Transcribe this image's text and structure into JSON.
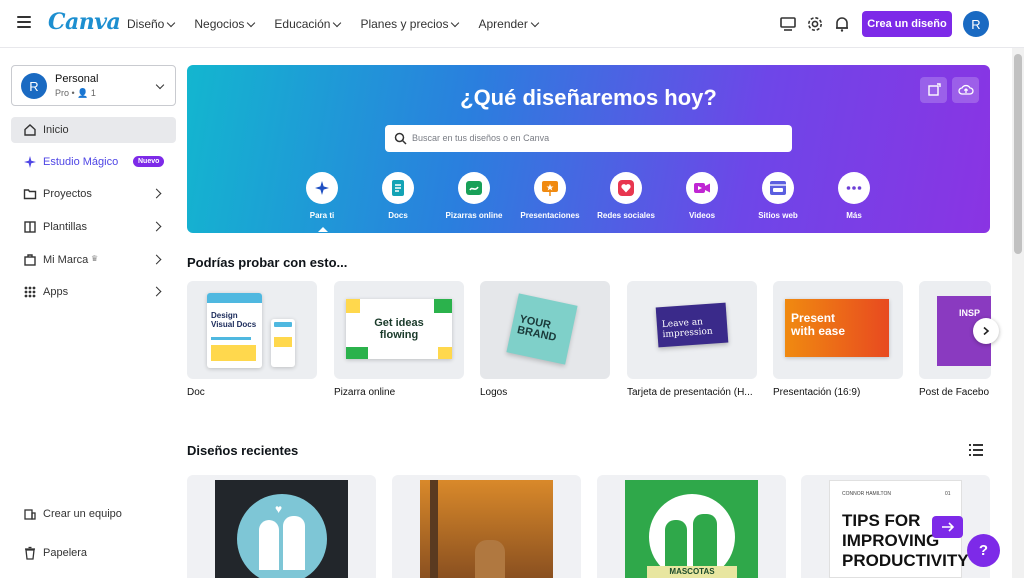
{
  "brand": {
    "name": "Canva",
    "accent": "#7d2ae8",
    "logo_color": "#1d8fd0"
  },
  "nav": [
    {
      "label": "Diseño"
    },
    {
      "label": "Negocios"
    },
    {
      "label": "Educación"
    },
    {
      "label": "Planes y precios"
    },
    {
      "label": "Aprender"
    }
  ],
  "topbar": {
    "create_label": "Crea un diseño",
    "avatar_initial": "R",
    "icons": [
      "desktop-icon",
      "gear-icon",
      "bell-icon"
    ]
  },
  "account": {
    "name": "Personal",
    "plan": "Pro • 👤 1",
    "initial": "R"
  },
  "sidebar": {
    "items": [
      {
        "label": "Inicio",
        "icon": "home-icon"
      },
      {
        "label": "Estudio Mágico",
        "icon": "magic-icon",
        "badge": "Nuevo"
      },
      {
        "label": "Proyectos",
        "icon": "folder-icon"
      },
      {
        "label": "Plantillas",
        "icon": "template-icon"
      },
      {
        "label": "Mi Marca",
        "icon": "brand-icon"
      },
      {
        "label": "Apps",
        "icon": "apps-icon"
      }
    ],
    "bottom": [
      {
        "label": "Crear un equipo",
        "icon": "team-icon"
      },
      {
        "label": "Papelera",
        "icon": "trash-icon"
      }
    ]
  },
  "hero": {
    "title": "¿Qué diseñaremos hoy?",
    "search_placeholder": "Buscar en tus diseños o en Canva",
    "categories": [
      {
        "label": "Para ti",
        "icon": "sparkle-icon",
        "color": "#1e4fc2"
      },
      {
        "label": "Docs",
        "icon": "doc-icon",
        "color": "#13a3b5"
      },
      {
        "label": "Pizarras online",
        "icon": "whiteboard-icon",
        "color": "#18a058"
      },
      {
        "label": "Presentaciones",
        "icon": "presentation-icon",
        "color": "#f08a10"
      },
      {
        "label": "Redes sociales",
        "icon": "heart-icon",
        "color": "#e8364f"
      },
      {
        "label": "Videos",
        "icon": "video-icon",
        "color": "#c026d3"
      },
      {
        "label": "Sitios web",
        "icon": "website-icon",
        "color": "#5b5fe0"
      },
      {
        "label": "Más",
        "icon": "more-icon",
        "color": "#6d3fd6"
      }
    ]
  },
  "suggestions": {
    "title": "Podrías probar con esto...",
    "cards": [
      {
        "label": "Doc",
        "thumb_text": "Design Visual Docs"
      },
      {
        "label": "Pizarra online",
        "thumb_text": "Get ideas flowing"
      },
      {
        "label": "Logos",
        "thumb_text": "YOUR BRAND"
      },
      {
        "label": "Tarjeta de presentación (H...",
        "thumb_text": "Leave an impression"
      },
      {
        "label": "Presentación (16:9)",
        "thumb_text": "Present with ease"
      },
      {
        "label": "Post de Facebo",
        "thumb_text": "INSP"
      }
    ]
  },
  "recent": {
    "title": "Diseños recientes",
    "thumb_texts": [
      "",
      "",
      "MASCOTAS",
      "TIPS FOR IMPROVING PRODUCTIVITY"
    ],
    "tips_header": "CONNOR HAMILTON",
    "tips_page": "01"
  },
  "help_label": "?"
}
